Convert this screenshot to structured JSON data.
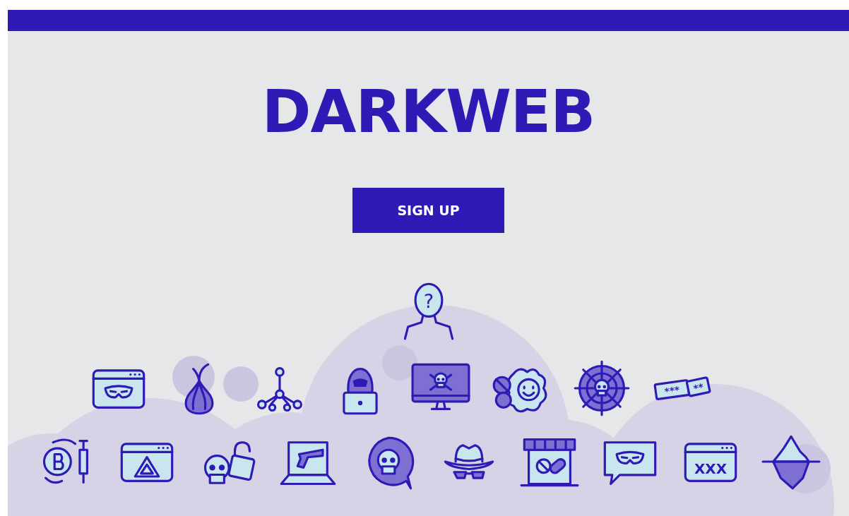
{
  "title": "DARKWEB",
  "sign_up_button": "SIGN UP",
  "top_icon": {
    "kind": "unknown-person",
    "label": "?"
  },
  "icon_rows": [
    [
      {
        "kind": "browser-mask"
      },
      {
        "kind": "onion"
      },
      {
        "kind": "network"
      },
      {
        "kind": "hacker-laptop"
      },
      {
        "kind": "monitor-skull"
      },
      {
        "kind": "pills"
      },
      {
        "kind": "spider-web"
      },
      {
        "kind": "password",
        "label": "***",
        "label_2": "**"
      }
    ],
    [
      {
        "kind": "coin-syringe"
      },
      {
        "kind": "browser-triangle"
      },
      {
        "kind": "skull-lock"
      },
      {
        "kind": "laptop-gun"
      },
      {
        "kind": "skull-bubble"
      },
      {
        "kind": "spy-hat"
      },
      {
        "kind": "shop-pills"
      },
      {
        "kind": "chat-mask"
      },
      {
        "kind": "browser-text",
        "label": "XXX"
      },
      {
        "kind": "iceberg"
      }
    ]
  ]
}
